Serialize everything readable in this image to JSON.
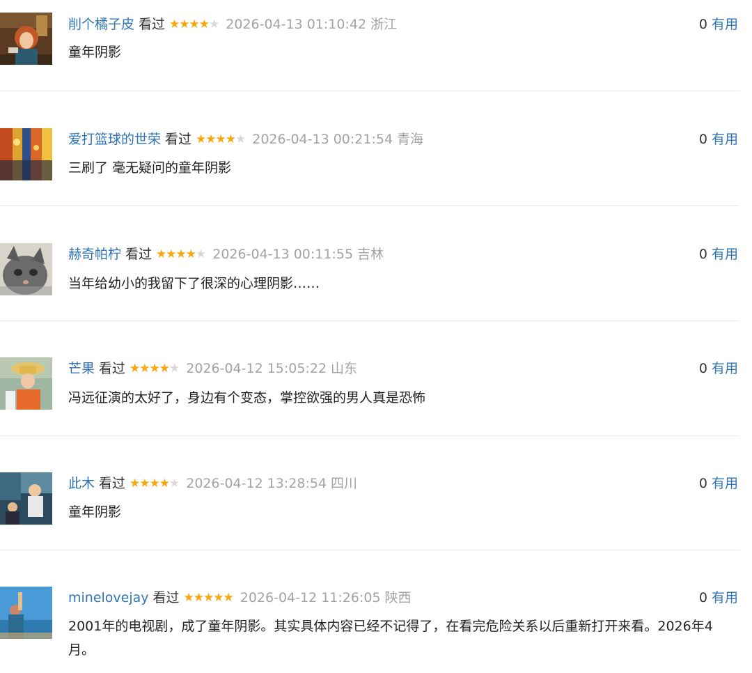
{
  "vote_label": "有用",
  "colors": {
    "username": "#2f74b5",
    "star_on": "#f7a70d",
    "star_off": "#d8d8d8",
    "timestamp": "#a3a3a3",
    "divider": "#e8e8e8"
  },
  "comments": [
    {
      "user": "削个橘子皮",
      "status": "看过",
      "rating": 4,
      "time": "2026-04-13 01:10:42",
      "location": "浙江",
      "votes": "0",
      "content": "童年阴影",
      "avatar_icon": "avatar-cartoon-girl-red-hair"
    },
    {
      "user": "爱打篮球的世荣",
      "status": "看过",
      "rating": 4,
      "time": "2026-04-13 00:21:54",
      "location": "青海",
      "votes": "0",
      "content": "三刷了 毫无疑问的童年阴影",
      "avatar_icon": "avatar-painting-street"
    },
    {
      "user": "赫奇帕柠",
      "status": "看过",
      "rating": 4,
      "time": "2026-04-13 00:11:55",
      "location": "吉林",
      "votes": "0",
      "content": "当年给幼小的我留下了很深的心理阴影……",
      "avatar_icon": "avatar-gray-cat"
    },
    {
      "user": "芒果",
      "status": "看过",
      "rating": 4,
      "time": "2026-04-12 15:05:22",
      "location": "山东",
      "votes": "0",
      "content": "冯远征演的太好了，身边有个变态，掌控欲强的男人真是恐怖",
      "avatar_icon": "avatar-person-straw-hat"
    },
    {
      "user": "此木",
      "status": "看过",
      "rating": 4,
      "time": "2026-04-12 13:28:54",
      "location": "四川",
      "votes": "0",
      "content": "童年阴影",
      "avatar_icon": "avatar-anime-scene"
    },
    {
      "user": "minelovejay",
      "status": "看过",
      "rating": 5,
      "time": "2026-04-12 11:26:05",
      "location": "陕西",
      "votes": "0",
      "content": "2001年的电视剧，成了童年阴影。其实具体内容已经不记得了，在看完危险关系以后重新打开来看。2026年4月。",
      "avatar_icon": "avatar-person-sky"
    }
  ]
}
